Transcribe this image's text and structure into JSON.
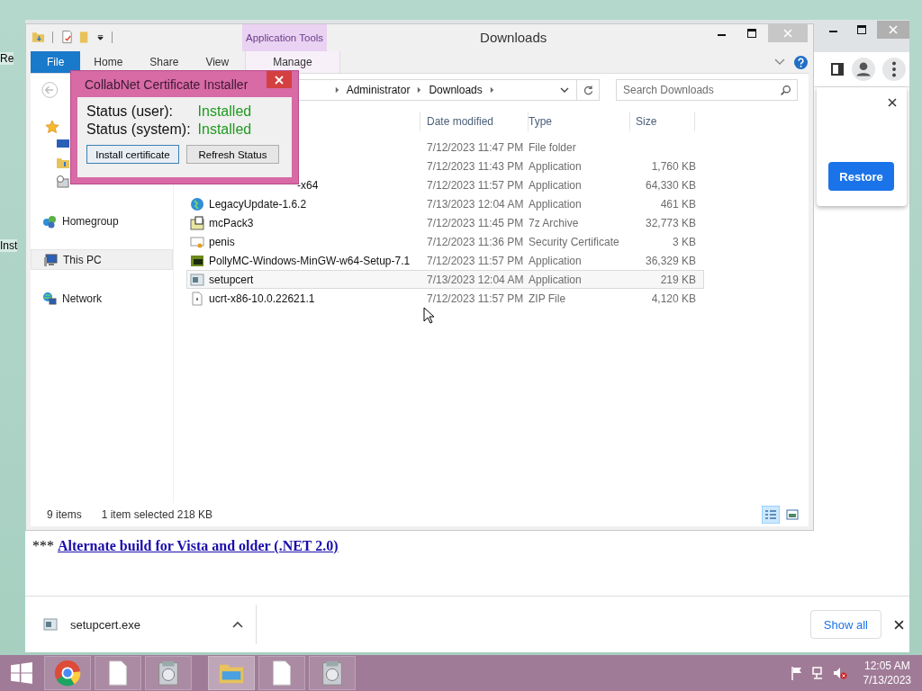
{
  "desktop_icons": [
    {
      "label": "Re"
    },
    {
      "label": "Inst"
    }
  ],
  "browser": {
    "restore_popup": {
      "button": "Restore"
    },
    "page_text": {
      "prefix": "***",
      "link": "Alternate build for Vista and older (.NET 2.0)"
    },
    "download_bar": {
      "file": "setupcert.exe",
      "button": "Show all"
    }
  },
  "explorer": {
    "title": "Downloads",
    "contextual_tab_group": "Application Tools",
    "ribbon_tabs": [
      {
        "label": "File",
        "kind": "file",
        "selected": false
      },
      {
        "label": "Home",
        "kind": "tab",
        "selected": false
      },
      {
        "label": "Share",
        "kind": "tab",
        "selected": false
      },
      {
        "label": "View",
        "kind": "tab",
        "selected": false
      },
      {
        "label": "Manage",
        "kind": "contextual",
        "selected": false
      }
    ],
    "breadcrumb": [
      "Administrator",
      "Downloads"
    ],
    "search": {
      "placeholder": "Search Downloads"
    },
    "nav": [
      {
        "label": "Homegroup",
        "kind": "homegroup",
        "selected": false
      },
      {
        "label": "This PC",
        "kind": "pc",
        "selected": true
      },
      {
        "label": "Network",
        "kind": "network",
        "selected": false
      }
    ],
    "columns": [
      "Date modified",
      "Type",
      "Size"
    ],
    "files": [
      {
        "date": "7/12/2023 11:47 PM",
        "type": "File folder",
        "selected": false
      },
      {
        "date": "7/12/2023 11:43 PM",
        "type": "Application",
        "size": "1,760 KB",
        "selected": false
      },
      {
        "name": "-x64",
        "covered": true,
        "date": "7/12/2023 11:57 PM",
        "type": "Application",
        "size": "64,330 KB",
        "selected": false
      },
      {
        "kind": "globe",
        "name": "LegacyUpdate-1.6.2",
        "date": "7/13/2023 12:04 AM",
        "type": "Application",
        "size": "461 KB",
        "selected": false
      },
      {
        "kind": "archive",
        "name": "mcPack3",
        "date": "7/12/2023 11:45 PM",
        "type": "7z Archive",
        "size": "32,773 KB",
        "selected": false
      },
      {
        "kind": "cert",
        "name": "penis",
        "date": "7/12/2023 11:36 PM",
        "type": "Security Certificate",
        "size": "3 KB",
        "selected": false
      },
      {
        "kind": "dark-app",
        "name": "PollyMC-Windows-MinGW-w64-Setup-7.1",
        "date": "7/12/2023 11:57 PM",
        "type": "Application",
        "size": "36,329 KB",
        "selected": false
      },
      {
        "kind": "app",
        "name": "setupcert",
        "date": "7/13/2023 12:04 AM",
        "type": "Application",
        "size": "219 KB",
        "selected": true
      },
      {
        "kind": "zip",
        "name": "ucrt-x86-10.0.22621.1",
        "date": "7/12/2023 11:57 PM",
        "type": "ZIP File",
        "size": "4,120 KB",
        "selected": false
      }
    ],
    "status": {
      "count": "9 items",
      "selection": "1 item selected  218 KB"
    },
    "view_buttons": [
      {
        "kind": "details",
        "selected": true
      },
      {
        "kind": "tiles",
        "selected": false
      }
    ]
  },
  "dialog": {
    "title": "CollabNet Certificate Installer",
    "statuses": [
      {
        "label": "Status (user):",
        "value": "Installed"
      },
      {
        "label": "Status (system):",
        "value": "Installed"
      }
    ],
    "buttons": [
      {
        "label": "Install certificate",
        "default": true
      },
      {
        "label": "Refresh Status",
        "default": false
      }
    ]
  },
  "taskbar": {
    "items": [
      {
        "kind": "chrome",
        "active": false
      },
      {
        "kind": "document",
        "active": false
      },
      {
        "kind": "installer",
        "active": false
      },
      {
        "kind": "explorer",
        "active": true
      },
      {
        "kind": "document",
        "active": false
      },
      {
        "kind": "installer",
        "active": false
      }
    ],
    "clock": {
      "time": "12:05 AM",
      "date": "7/13/2023"
    }
  }
}
